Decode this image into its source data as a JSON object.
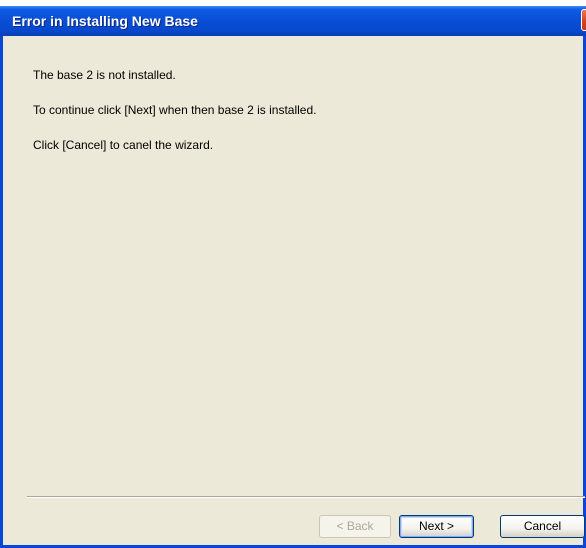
{
  "window": {
    "title": "Error in Installing New Base"
  },
  "content": {
    "lines": [
      "The base 2 is not installed.",
      "To continue click [Next] when then base 2 is installed.",
      "Click [Cancel] to canel the wizard."
    ]
  },
  "buttons": {
    "back": "< Back",
    "next": "Next >",
    "cancel": "Cancel"
  },
  "colors": {
    "titlebar": "#0a4fd8",
    "window_bg": "#ece9d8",
    "close_button": "#d4451f"
  }
}
